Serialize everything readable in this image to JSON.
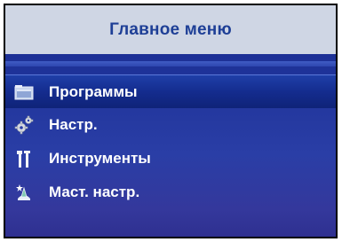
{
  "header": {
    "title": "Главное меню"
  },
  "menu": {
    "selected_index": 0,
    "items": [
      {
        "label": "Программы",
        "icon": "folder-icon"
      },
      {
        "label": "Настр.",
        "icon": "gears-icon"
      },
      {
        "label": "Инструменты",
        "icon": "tools-icon"
      },
      {
        "label": "Маст. настр.",
        "icon": "setup-wizard-icon"
      }
    ]
  },
  "colors": {
    "header_bg": "#cfd6e4",
    "header_text": "#1e3f96",
    "menu_bg": "#2a3ea6",
    "selected_bg": "#142c8e",
    "item_text": "#ffffff"
  }
}
